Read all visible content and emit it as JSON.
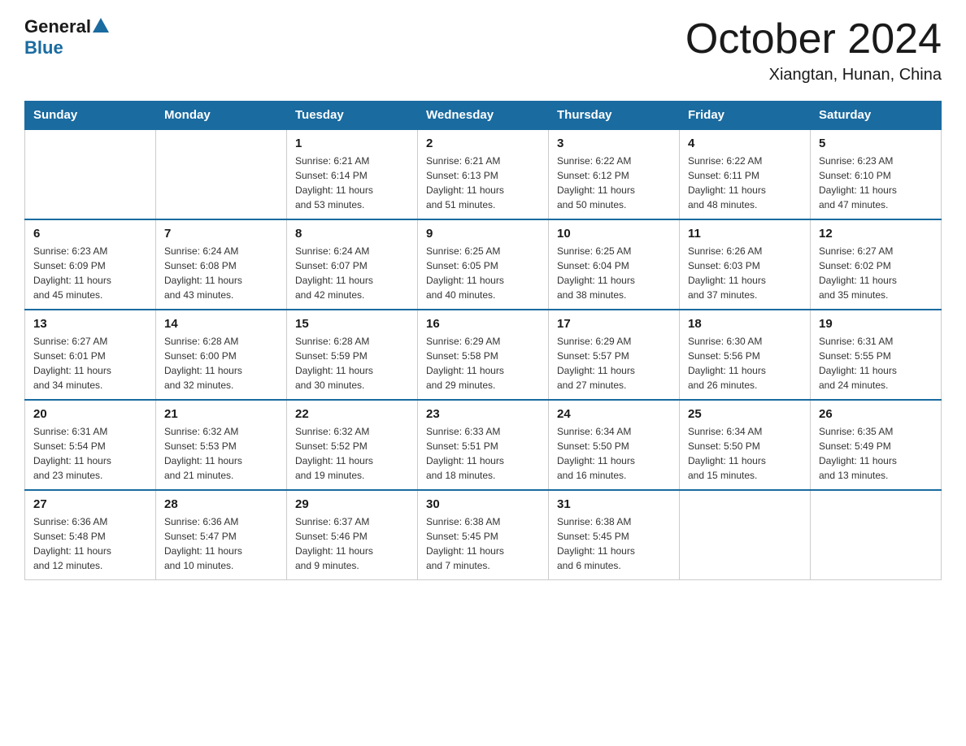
{
  "header": {
    "logo_general": "General",
    "logo_blue": "Blue",
    "month": "October 2024",
    "location": "Xiangtan, Hunan, China"
  },
  "days_of_week": [
    "Sunday",
    "Monday",
    "Tuesday",
    "Wednesday",
    "Thursday",
    "Friday",
    "Saturday"
  ],
  "weeks": [
    [
      {
        "day": "",
        "info": ""
      },
      {
        "day": "",
        "info": ""
      },
      {
        "day": "1",
        "info": "Sunrise: 6:21 AM\nSunset: 6:14 PM\nDaylight: 11 hours\nand 53 minutes."
      },
      {
        "day": "2",
        "info": "Sunrise: 6:21 AM\nSunset: 6:13 PM\nDaylight: 11 hours\nand 51 minutes."
      },
      {
        "day": "3",
        "info": "Sunrise: 6:22 AM\nSunset: 6:12 PM\nDaylight: 11 hours\nand 50 minutes."
      },
      {
        "day": "4",
        "info": "Sunrise: 6:22 AM\nSunset: 6:11 PM\nDaylight: 11 hours\nand 48 minutes."
      },
      {
        "day": "5",
        "info": "Sunrise: 6:23 AM\nSunset: 6:10 PM\nDaylight: 11 hours\nand 47 minutes."
      }
    ],
    [
      {
        "day": "6",
        "info": "Sunrise: 6:23 AM\nSunset: 6:09 PM\nDaylight: 11 hours\nand 45 minutes."
      },
      {
        "day": "7",
        "info": "Sunrise: 6:24 AM\nSunset: 6:08 PM\nDaylight: 11 hours\nand 43 minutes."
      },
      {
        "day": "8",
        "info": "Sunrise: 6:24 AM\nSunset: 6:07 PM\nDaylight: 11 hours\nand 42 minutes."
      },
      {
        "day": "9",
        "info": "Sunrise: 6:25 AM\nSunset: 6:05 PM\nDaylight: 11 hours\nand 40 minutes."
      },
      {
        "day": "10",
        "info": "Sunrise: 6:25 AM\nSunset: 6:04 PM\nDaylight: 11 hours\nand 38 minutes."
      },
      {
        "day": "11",
        "info": "Sunrise: 6:26 AM\nSunset: 6:03 PM\nDaylight: 11 hours\nand 37 minutes."
      },
      {
        "day": "12",
        "info": "Sunrise: 6:27 AM\nSunset: 6:02 PM\nDaylight: 11 hours\nand 35 minutes."
      }
    ],
    [
      {
        "day": "13",
        "info": "Sunrise: 6:27 AM\nSunset: 6:01 PM\nDaylight: 11 hours\nand 34 minutes."
      },
      {
        "day": "14",
        "info": "Sunrise: 6:28 AM\nSunset: 6:00 PM\nDaylight: 11 hours\nand 32 minutes."
      },
      {
        "day": "15",
        "info": "Sunrise: 6:28 AM\nSunset: 5:59 PM\nDaylight: 11 hours\nand 30 minutes."
      },
      {
        "day": "16",
        "info": "Sunrise: 6:29 AM\nSunset: 5:58 PM\nDaylight: 11 hours\nand 29 minutes."
      },
      {
        "day": "17",
        "info": "Sunrise: 6:29 AM\nSunset: 5:57 PM\nDaylight: 11 hours\nand 27 minutes."
      },
      {
        "day": "18",
        "info": "Sunrise: 6:30 AM\nSunset: 5:56 PM\nDaylight: 11 hours\nand 26 minutes."
      },
      {
        "day": "19",
        "info": "Sunrise: 6:31 AM\nSunset: 5:55 PM\nDaylight: 11 hours\nand 24 minutes."
      }
    ],
    [
      {
        "day": "20",
        "info": "Sunrise: 6:31 AM\nSunset: 5:54 PM\nDaylight: 11 hours\nand 23 minutes."
      },
      {
        "day": "21",
        "info": "Sunrise: 6:32 AM\nSunset: 5:53 PM\nDaylight: 11 hours\nand 21 minutes."
      },
      {
        "day": "22",
        "info": "Sunrise: 6:32 AM\nSunset: 5:52 PM\nDaylight: 11 hours\nand 19 minutes."
      },
      {
        "day": "23",
        "info": "Sunrise: 6:33 AM\nSunset: 5:51 PM\nDaylight: 11 hours\nand 18 minutes."
      },
      {
        "day": "24",
        "info": "Sunrise: 6:34 AM\nSunset: 5:50 PM\nDaylight: 11 hours\nand 16 minutes."
      },
      {
        "day": "25",
        "info": "Sunrise: 6:34 AM\nSunset: 5:50 PM\nDaylight: 11 hours\nand 15 minutes."
      },
      {
        "day": "26",
        "info": "Sunrise: 6:35 AM\nSunset: 5:49 PM\nDaylight: 11 hours\nand 13 minutes."
      }
    ],
    [
      {
        "day": "27",
        "info": "Sunrise: 6:36 AM\nSunset: 5:48 PM\nDaylight: 11 hours\nand 12 minutes."
      },
      {
        "day": "28",
        "info": "Sunrise: 6:36 AM\nSunset: 5:47 PM\nDaylight: 11 hours\nand 10 minutes."
      },
      {
        "day": "29",
        "info": "Sunrise: 6:37 AM\nSunset: 5:46 PM\nDaylight: 11 hours\nand 9 minutes."
      },
      {
        "day": "30",
        "info": "Sunrise: 6:38 AM\nSunset: 5:45 PM\nDaylight: 11 hours\nand 7 minutes."
      },
      {
        "day": "31",
        "info": "Sunrise: 6:38 AM\nSunset: 5:45 PM\nDaylight: 11 hours\nand 6 minutes."
      },
      {
        "day": "",
        "info": ""
      },
      {
        "day": "",
        "info": ""
      }
    ]
  ]
}
